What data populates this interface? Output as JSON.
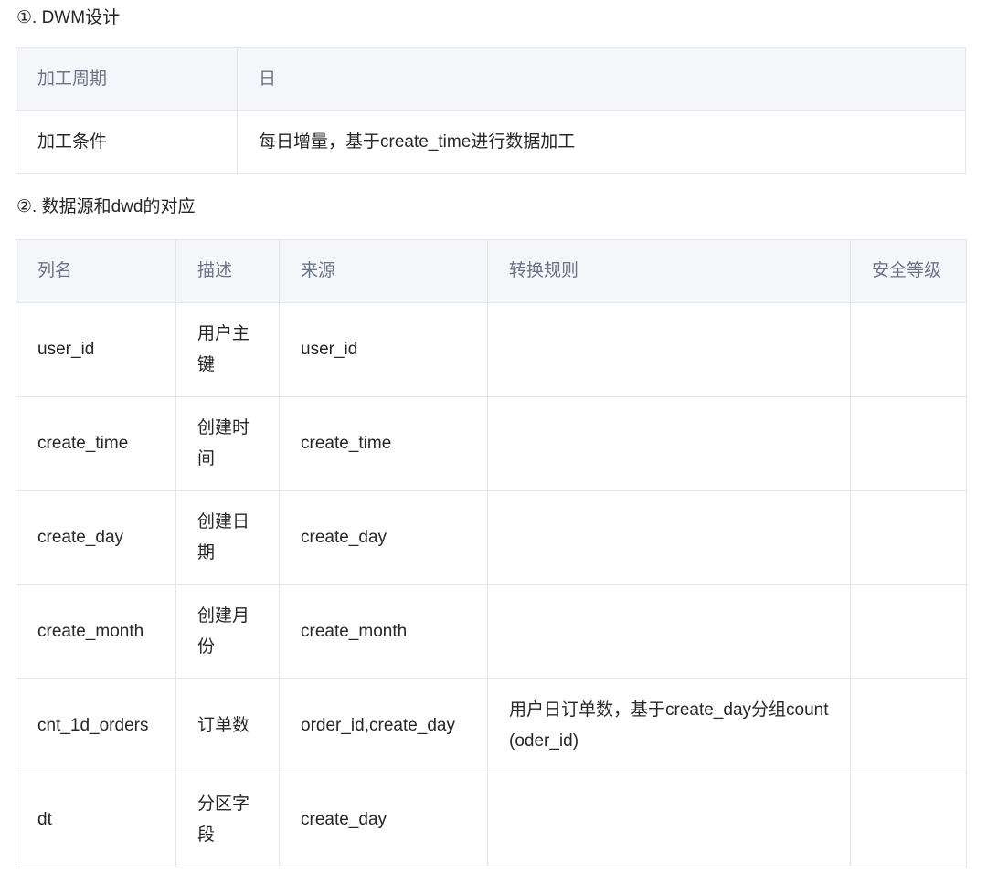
{
  "section1": {
    "heading": "①. DWM设计",
    "rows": [
      {
        "label": "加工周期",
        "value": "日"
      },
      {
        "label": "加工条件",
        "value": "每日增量，基于create_time进行数据加工"
      }
    ]
  },
  "section2": {
    "heading": "②. 数据源和dwd的对应",
    "headers": [
      "列名",
      "描述",
      "来源",
      "转换规则",
      "安全等级"
    ],
    "rows": [
      {
        "column": "user_id",
        "desc": "用户主键",
        "source": "user_id",
        "rule": "",
        "level": ""
      },
      {
        "column": "create_time",
        "desc": "创建时间",
        "source": "create_time",
        "rule": "",
        "level": ""
      },
      {
        "column": "create_day",
        "desc": "创建日期",
        "source": "create_day",
        "rule": "",
        "level": ""
      },
      {
        "column": "create_month",
        "desc": "创建月份",
        "source": "create_month",
        "rule": "",
        "level": ""
      },
      {
        "column": "cnt_1d_orders",
        "desc": "订单数",
        "source": "order_id,create_day",
        "rule": "用户日订单数，基于create_day分组count(oder_id)",
        "level": ""
      },
      {
        "column": "dt",
        "desc": "分区字段",
        "source": "create_day",
        "rule": "",
        "level": ""
      }
    ]
  }
}
